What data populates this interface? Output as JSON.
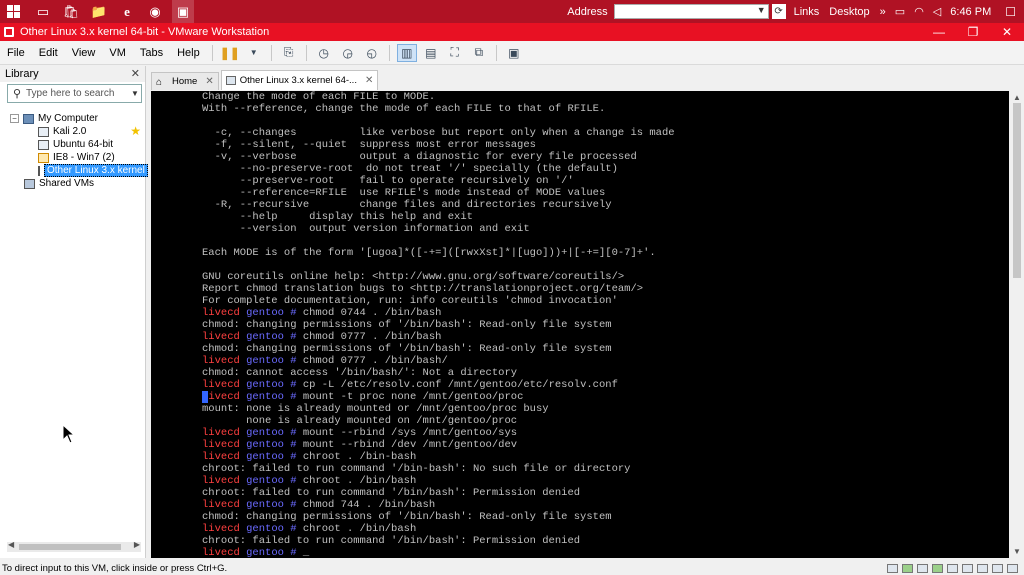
{
  "taskbar": {
    "address_label": "Address",
    "address_value": "",
    "links_label": "Links",
    "desktop_label": "Desktop",
    "chevron": "»",
    "clock": "6:46 PM"
  },
  "window": {
    "title": "Other Linux 3.x kernel 64-bit - VMware Workstation",
    "minimize": "—",
    "maximize": "❐",
    "close": "✕"
  },
  "menu": {
    "items": [
      "File",
      "Edit",
      "View",
      "VM",
      "Tabs",
      "Help"
    ]
  },
  "library": {
    "title": "Library",
    "close": "✕",
    "search_placeholder": "Type here to search",
    "tree": {
      "root": "My Computer",
      "children": [
        "Kali 2.0",
        "Ubuntu 64-bit",
        "IE8 - Win7 (2)",
        "Other Linux 3.x kernel"
      ],
      "shared": "Shared VMs"
    }
  },
  "tabs": [
    {
      "label": "Home",
      "close": "✕"
    },
    {
      "label": "Other Linux 3.x kernel 64-...",
      "close": "✕"
    }
  ],
  "terminal": {
    "lines": [
      {
        "t": "Change the mode of each FILE to MODE."
      },
      {
        "t": "With --reference, change the mode of each FILE to that of RFILE."
      },
      {
        "t": ""
      },
      {
        "t": "  -c, --changes          like verbose but report only when a change is made"
      },
      {
        "t": "  -f, --silent, --quiet  suppress most error messages"
      },
      {
        "t": "  -v, --verbose          output a diagnostic for every file processed"
      },
      {
        "t": "      --no-preserve-root  do not treat '/' specially (the default)"
      },
      {
        "t": "      --preserve-root    fail to operate recursively on '/'"
      },
      {
        "t": "      --reference=RFILE  use RFILE's mode instead of MODE values"
      },
      {
        "t": "  -R, --recursive        change files and directories recursively"
      },
      {
        "t": "      --help     display this help and exit"
      },
      {
        "t": "      --version  output version information and exit"
      },
      {
        "t": ""
      },
      {
        "t": "Each MODE is of the form '[ugoa]*([-+=]([rwxXst]*|[ugo]))+|[-+=][0-7]+'."
      },
      {
        "t": ""
      },
      {
        "t": "GNU coreutils online help: <http://www.gnu.org/software/coreutils/>"
      },
      {
        "t": "Report chmod translation bugs to <http://translationproject.org/team/>"
      },
      {
        "t": "For complete documentation, run: info coreutils 'chmod invocation'"
      },
      {
        "p": true,
        "c": "chmod 0744 . /bin/bash"
      },
      {
        "t": "chmod: changing permissions of '/bin/bash': Read-only file system"
      },
      {
        "p": true,
        "c": "chmod 0777 . /bin/bash"
      },
      {
        "t": "chmod: changing permissions of '/bin/bash': Read-only file system"
      },
      {
        "p": true,
        "c": "chmod 0777 . /bin/bash/"
      },
      {
        "t": "chmod: cannot access '/bin/bash/': Not a directory"
      },
      {
        "p": true,
        "c": "cp -L /etc/resolv.conf /mnt/gentoo/etc/resolv.conf"
      },
      {
        "p": true,
        "c": "mount -t proc none /mnt/gentoo/proc",
        "cur": true
      },
      {
        "t": "mount: none is already mounted or /mnt/gentoo/proc busy"
      },
      {
        "t": "       none is already mounted on /mnt/gentoo/proc"
      },
      {
        "p": true,
        "c": "mount --rbind /sys /mnt/gentoo/sys"
      },
      {
        "p": true,
        "c": "mount --rbind /dev /mnt/gentoo/dev"
      },
      {
        "p": true,
        "c": "chroot . /bin-bash"
      },
      {
        "t": "chroot: failed to run command '/bin-bash': No such file or directory"
      },
      {
        "p": true,
        "c": "chroot . /bin/bash"
      },
      {
        "t": "chroot: failed to run command '/bin/bash': Permission denied"
      },
      {
        "p": true,
        "c": "chmod 744 . /bin/bash"
      },
      {
        "t": "chmod: changing permissions of '/bin/bash': Read-only file system"
      },
      {
        "p": true,
        "c": "chroot . /bin/bash"
      },
      {
        "t": "chroot: failed to run command '/bin/bash': Permission denied"
      },
      {
        "p": true,
        "c": "_"
      }
    ],
    "prompt_user": "livecd",
    "prompt_dir": "gentoo",
    "prompt_sym": "#"
  },
  "status": {
    "text": "To direct input to this VM, click inside or press Ctrl+G."
  },
  "colors": {
    "taskbar": "#b01224",
    "titlebar": "#e81123",
    "prompt_host": "#ff4040",
    "prompt_path": "#6a6aff"
  }
}
